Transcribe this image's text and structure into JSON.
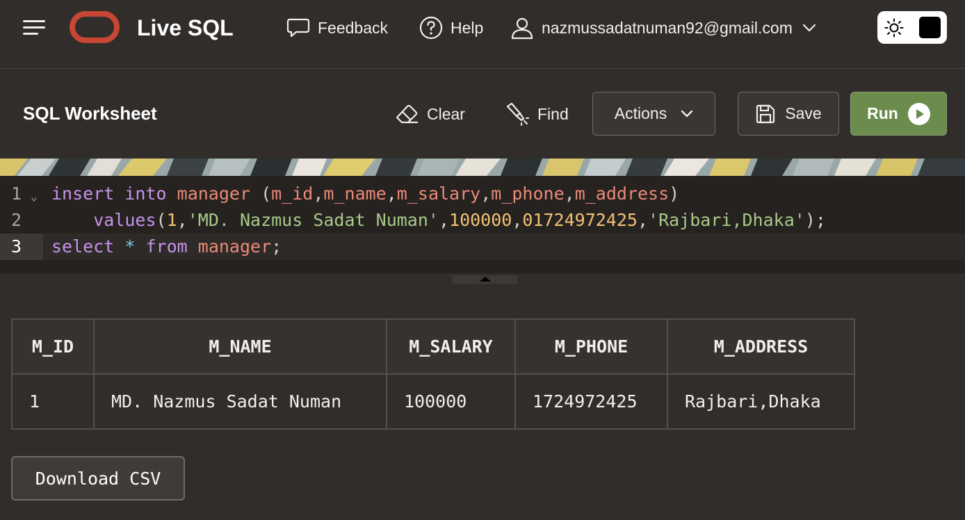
{
  "header": {
    "app_title": "Live SQL",
    "feedback_label": "Feedback",
    "help_label": "Help",
    "user_email": "nazmussadatnuman92@gmail.com"
  },
  "worksheet": {
    "title": "SQL Worksheet",
    "clear_label": "Clear",
    "find_label": "Find",
    "actions_label": "Actions",
    "save_label": "Save",
    "run_label": "Run"
  },
  "editor": {
    "line_numbers": [
      "1",
      "2",
      "3"
    ],
    "active_line": 3
  },
  "results": {
    "columns": [
      "M_ID",
      "M_NAME",
      "M_SALARY",
      "M_PHONE",
      "M_ADDRESS"
    ],
    "rows": [
      [
        "1",
        "MD. Nazmus Sadat Numan",
        "100000",
        "1724972425",
        "Rajbari,Dhaka"
      ]
    ],
    "download_label": "Download CSV"
  },
  "colors": {
    "background": "#312d2a",
    "brand_logo": "#c74634",
    "run_button": "#6b8c4d",
    "editor_background": "#252220"
  }
}
